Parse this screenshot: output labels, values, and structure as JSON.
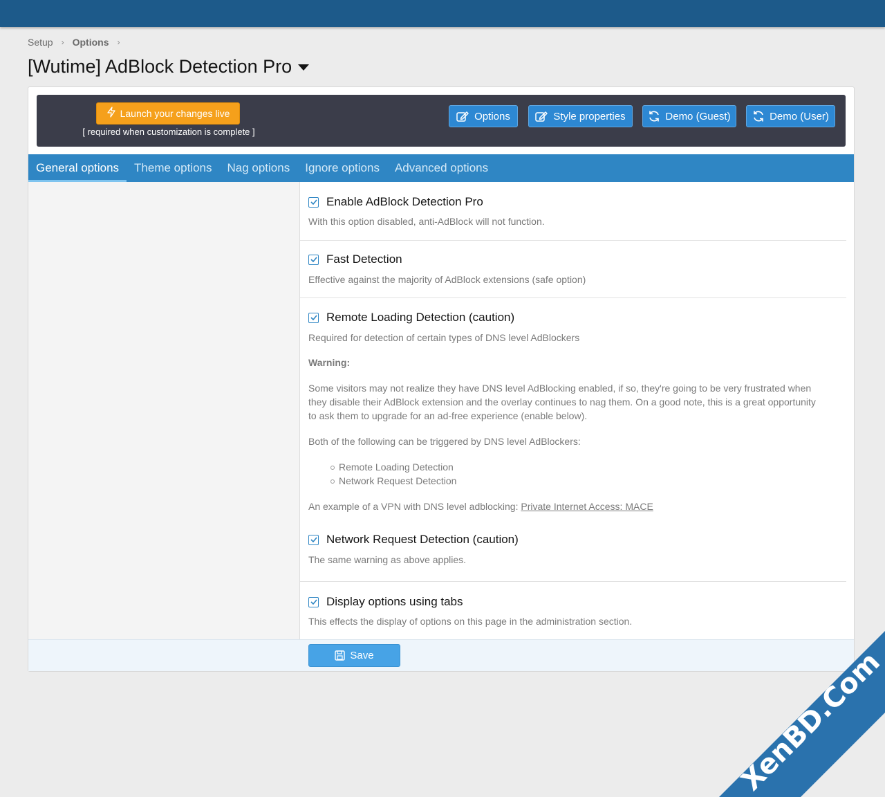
{
  "breadcrumb": {
    "items": [
      "Setup",
      "Options"
    ]
  },
  "page": {
    "title": "[Wutime] AdBlock Detection Pro"
  },
  "banner": {
    "launch_label": "Launch your changes live",
    "launch_note": "[ required when customization is complete ]",
    "buttons": {
      "options": "Options",
      "style": "Style properties",
      "demo_guest": "Demo (Guest)",
      "demo_user": "Demo (User)"
    }
  },
  "tabs": [
    "General options",
    "Theme options",
    "Nag options",
    "Ignore options",
    "Advanced options"
  ],
  "options": {
    "enable": {
      "label": "Enable AdBlock Detection Pro",
      "checked": true,
      "hint": "With this option disabled, anti-AdBlock will not function."
    },
    "fast": {
      "label": "Fast Detection",
      "checked": true,
      "hint": "Effective against the majority of AdBlock extensions (safe option)"
    },
    "remote": {
      "label": "Remote Loading Detection (caution)",
      "checked": true,
      "hint": "Required for detection of certain types of DNS level AdBlockers",
      "warning_title": "Warning:",
      "warning_line1": "Some visitors may not realize they have DNS level AdBlocking enabled, if so, they're going to be very frustrated when",
      "warning_line2": "they disable their AdBlock extension and the overlay continues to nag them. On a good note, this is a great opportunity",
      "warning_line3": "to ask them to upgrade for an ad-free experience (enable below).",
      "both_text": "Both of the following can be triggered by DNS level AdBlockers:",
      "bullets": [
        "Remote Loading Detection",
        "Network Request Detection"
      ],
      "example_text": "An example of a VPN with DNS level adblocking: ",
      "example_link": "Private Internet Access: MACE"
    },
    "network": {
      "label": "Network Request Detection (caution)",
      "checked": true,
      "hint": "The same warning as above applies."
    },
    "tabs": {
      "label": "Display options using tabs",
      "checked": true,
      "hint": "This effects the display of options on this page in the administration section."
    }
  },
  "footer": {
    "save_label": "Save"
  },
  "watermark": {
    "text": "XenBD.Com"
  },
  "colors": {
    "topbar": "#1d5a8a",
    "tabs": "#2f86c4",
    "accent_orange": "#f5a01b",
    "button_blue": "#2d88d3",
    "save_blue": "#47a3e6",
    "banner_dark": "#3b3d4a"
  }
}
